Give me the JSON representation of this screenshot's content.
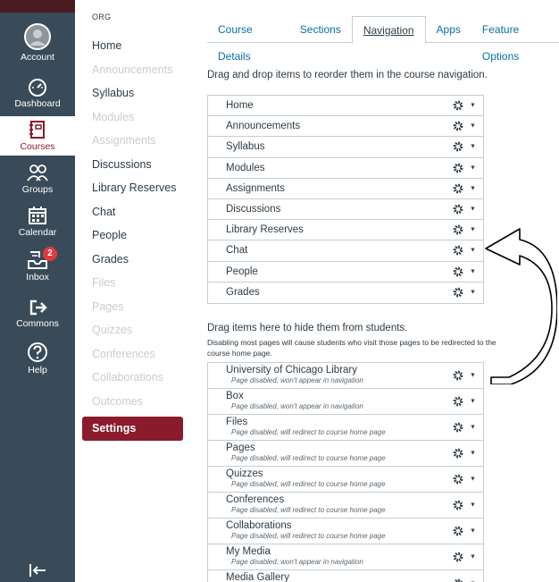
{
  "global_nav": {
    "items": [
      {
        "label": "Account",
        "icon": "account-avatar-icon"
      },
      {
        "label": "Dashboard",
        "icon": "dashboard-gauge-icon"
      },
      {
        "label": "Courses",
        "icon": "courses-book-icon",
        "active": true
      },
      {
        "label": "Groups",
        "icon": "groups-people-icon"
      },
      {
        "label": "Calendar",
        "icon": "calendar-icon"
      },
      {
        "label": "Inbox",
        "icon": "inbox-icon",
        "badge": "2"
      },
      {
        "label": "Commons",
        "icon": "commons-arrow-icon"
      },
      {
        "label": "Help",
        "icon": "help-question-icon"
      }
    ],
    "collapse_icon": "collapse-arrow-icon"
  },
  "course_nav": {
    "org_label": "ORG",
    "items": [
      {
        "label": "Home",
        "disabled": false
      },
      {
        "label": "Announcements",
        "disabled": true
      },
      {
        "label": "Syllabus",
        "disabled": false
      },
      {
        "label": "Modules",
        "disabled": true
      },
      {
        "label": "Assignments",
        "disabled": true
      },
      {
        "label": "Discussions",
        "disabled": false
      },
      {
        "label": "Library Reserves",
        "disabled": false
      },
      {
        "label": "Chat",
        "disabled": false
      },
      {
        "label": "People",
        "disabled": false
      },
      {
        "label": "Grades",
        "disabled": false
      },
      {
        "label": "Files",
        "disabled": true
      },
      {
        "label": "Pages",
        "disabled": true
      },
      {
        "label": "Quizzes",
        "disabled": true
      },
      {
        "label": "Conferences",
        "disabled": true
      },
      {
        "label": "Collaborations",
        "disabled": true
      },
      {
        "label": "Outcomes",
        "disabled": true
      },
      {
        "label": "Settings",
        "active": true
      }
    ]
  },
  "tabs": [
    {
      "label": "Course Details"
    },
    {
      "label": "Sections"
    },
    {
      "label": "Navigation",
      "active": true
    },
    {
      "label": "Apps"
    },
    {
      "label": "Feature Options"
    }
  ],
  "instructions": "Drag and drop items to reorder them in the course navigation.",
  "visible_items": [
    "Home",
    "Announcements",
    "Syllabus",
    "Modules",
    "Assignments",
    "Discussions",
    "Library Reserves",
    "Chat",
    "People",
    "Grades"
  ],
  "hidden_section": {
    "heading": "Drag items here to hide them from students.",
    "note": "Disabling most pages will cause students who visit those pages to be redirected to the course home page.",
    "items": [
      {
        "name": "University of Chicago Library",
        "status": "Page disabled, won't appear in navigation"
      },
      {
        "name": "Box",
        "status": "Page disabled, won't appear in navigation"
      },
      {
        "name": "Files",
        "status": "Page disabled, will redirect to course home page"
      },
      {
        "name": "Pages",
        "status": "Page disabled, will redirect to course home page"
      },
      {
        "name": "Quizzes",
        "status": "Page disabled, will redirect to course home page"
      },
      {
        "name": "Conferences",
        "status": "Page disabled, will redirect to course home page"
      },
      {
        "name": "Collaborations",
        "status": "Page disabled, will redirect to course home page"
      },
      {
        "name": "My Media",
        "status": "Page disabled, won't appear in navigation"
      },
      {
        "name": "Media Gallery",
        "status": ""
      }
    ]
  },
  "colors": {
    "global_nav_bg": "#394b58",
    "brand": "#8b1a2b",
    "link": "#0770a3",
    "disabled_text": "#c7cdd1"
  }
}
